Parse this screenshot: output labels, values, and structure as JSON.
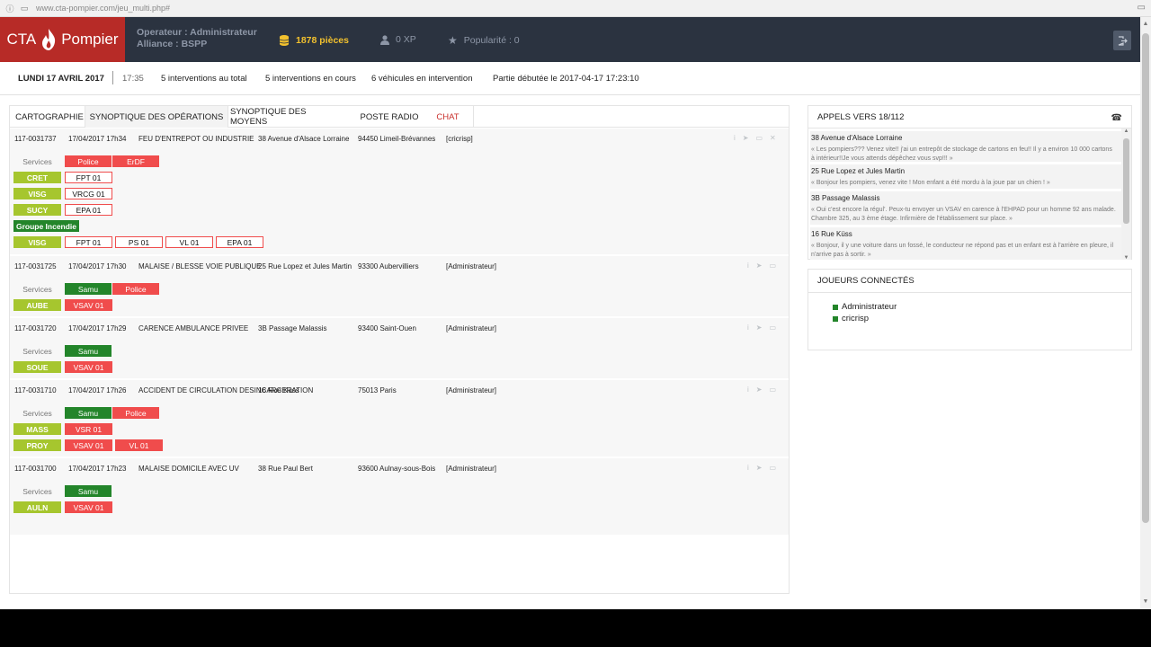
{
  "browser": {
    "url": "www.cta-pompier.com/jeu_multi.php#"
  },
  "header": {
    "logo_left": "CTA",
    "logo_right": "Pompier",
    "operator": "Operateur : Administrateur",
    "alliance": "Alliance : BSPP",
    "coins": "1878 pièces",
    "xp": "0 XP",
    "popularity": "Popularité : 0"
  },
  "info": {
    "date": "LUNDI 17 AVRIL 2017",
    "time": "17:35",
    "total": "5 interventions au total",
    "ongoing": "5 interventions en cours",
    "vehicles": "6 véhicules en intervention",
    "started": "Partie débutée le 2017-04-17 17:23:10"
  },
  "tabs": [
    "CARTOGRAPHIE",
    "SYNOPTIQUE DES OPÉRATIONS",
    "SYNOPTIQUE DES MOYENS",
    "POSTE RADIO",
    "CHAT"
  ],
  "services_label": "Services",
  "operations": [
    {
      "id": "117-0031737",
      "dt": "17/04/2017 17h34",
      "type": "FEU D'ENTREPOT OU INDUSTRIE",
      "address": "38 Avenue d'Alsace Lorraine",
      "city": "94450 Limeil-Brévannes",
      "user": "[cricrisp]",
      "services": [
        "Police",
        "ErDF"
      ],
      "rows": [
        {
          "station": "CRET",
          "vehicles": [
            "FPT 01"
          ]
        },
        {
          "station": "VISG",
          "vehicles": [
            "VRCG 01"
          ]
        },
        {
          "station": "SUCY",
          "vehicles": [
            "EPA 01"
          ]
        }
      ],
      "group": "Groupe Incendie",
      "group_row": {
        "station": "VISG",
        "vehicles": [
          "FPT 01",
          "PS 01",
          "VL 01",
          "EPA 01"
        ]
      }
    },
    {
      "id": "117-0031725",
      "dt": "17/04/2017 17h30",
      "type": "MALAISE / BLESSE VOIE PUBLIQUE",
      "address": "25 Rue Lopez et Jules Martin",
      "city": "93300 Aubervilliers",
      "user": "[Administrateur]",
      "services": [
        "Samu",
        "Police"
      ],
      "rows": [
        {
          "station": "AUBE",
          "vehicles": [
            "VSAV 01"
          ]
        }
      ]
    },
    {
      "id": "117-0031720",
      "dt": "17/04/2017 17h29",
      "type": "CARENCE AMBULANCE PRIVEE",
      "address": "3B Passage Malassis",
      "city": "93400 Saint-Ouen",
      "user": "[Administrateur]",
      "services": [
        "Samu"
      ],
      "rows": [
        {
          "station": "SOUE",
          "vehicles": [
            "VSAV 01"
          ]
        }
      ]
    },
    {
      "id": "117-0031710",
      "dt": "17/04/2017 17h26",
      "type": "ACCIDENT DE CIRCULATION DESINCARCERATION",
      "address": "16 Rue Küss",
      "city": "75013 Paris",
      "user": "[Administrateur]",
      "services": [
        "Samu",
        "Police"
      ],
      "rows": [
        {
          "station": "MASS",
          "vehicles": [
            "VSR 01"
          ]
        },
        {
          "station": "PROY",
          "vehicles": [
            "VSAV 01",
            "VL 01"
          ]
        }
      ]
    },
    {
      "id": "117-0031700",
      "dt": "17/04/2017 17h23",
      "type": "MALAISE DOMICILE AVEC UV",
      "address": "38 Rue Paul Bert",
      "city": "93600 Aulnay-sous-Bois",
      "user": "[Administrateur]",
      "services": [
        "Samu"
      ],
      "rows": [
        {
          "station": "AULN",
          "vehicles": [
            "VSAV 01"
          ]
        }
      ]
    }
  ],
  "calls": {
    "title": "APPELS VERS 18/112",
    "items": [
      {
        "addr": "38 Avenue d'Alsace Lorraine",
        "msg": "« Les pompiers??? Venez vite!! j'ai un entrepôt de stockage de cartons en feu!! Il y a environ 10 000 cartons à intérieur!!Je vous attends dépêchez vous svp!!! »"
      },
      {
        "addr": "25 Rue Lopez et Jules Martin",
        "msg": "« Bonjour les pompiers, venez vite ! Mon enfant a été mordu à la joue par un chien ! »"
      },
      {
        "addr": "3B Passage Malassis",
        "msg": "« Oui c'est encore la régul'. Peux-tu envoyer un VSAV en carence à l'EHPAD pour un homme 92 ans malade. Chambre 325, au 3 ème étage. Infirmière de l'établissement sur place. »"
      },
      {
        "addr": "16 Rue Küss",
        "msg": "« Bonjour, il y une voiture dans un fossé, le conducteur ne répond pas et un enfant est à l'arrière en pleure, il n'arrive pas à sortir. »"
      }
    ]
  },
  "players": {
    "title": "JOUEURS CONNECTÉS",
    "items": [
      "Administrateur",
      "cricrisp"
    ]
  },
  "colors": {
    "red": "#f04c4c",
    "green": "#23852a",
    "lime": "#a6c62e",
    "nav": "#2b3340",
    "logo": "#b72b27"
  }
}
